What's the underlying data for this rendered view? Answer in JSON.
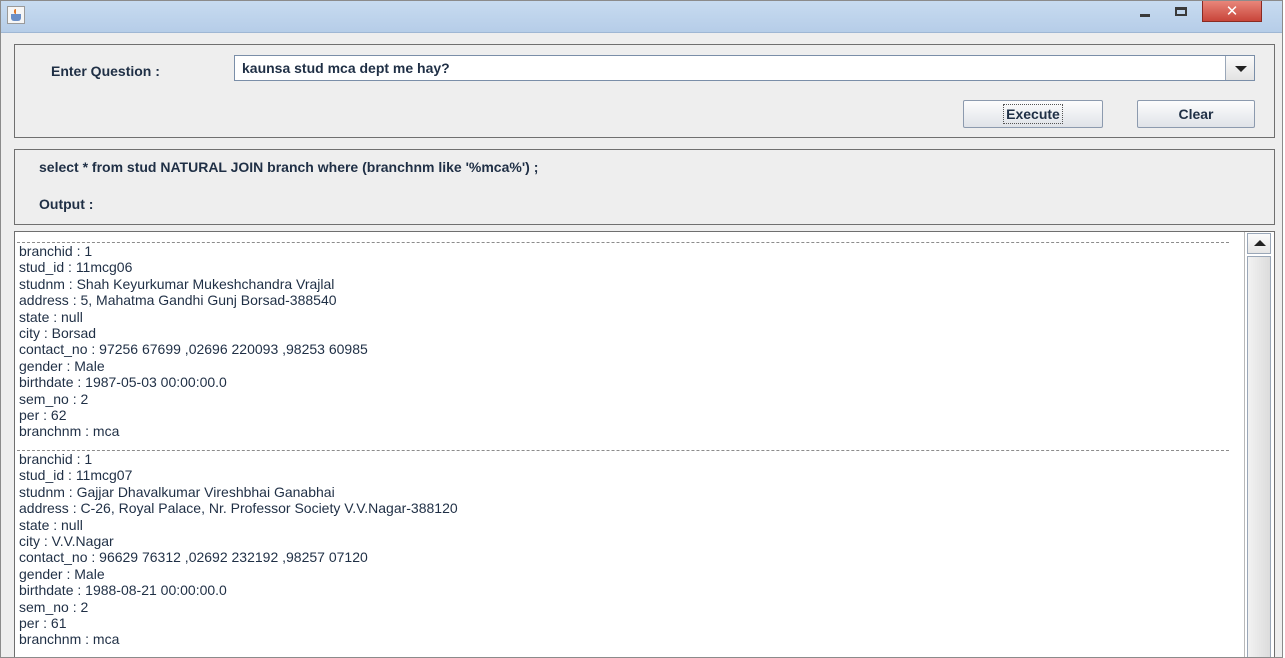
{
  "window": {
    "icon": "java-cup-icon",
    "close_glyph": "✕"
  },
  "question": {
    "label": "Enter Question :",
    "value": "kaunsa stud mca dept me hay?"
  },
  "buttons": {
    "execute": "Execute",
    "clear": "Clear"
  },
  "query": {
    "sql": "select * from stud NATURAL JOIN branch where (branchnm like '%mca%') ;",
    "output_label": "Output :"
  },
  "output": {
    "records": [
      [
        "branchid : 1",
        "stud_id : 11mcg06",
        "studnm : Shah Keyurkumar Mukeshchandra Vrajlal",
        "address : 5, Mahatma Gandhi Gunj Borsad-388540",
        "state : null",
        "city : Borsad",
        "contact_no : 97256 67699 ,02696 220093 ,98253 60985",
        "gender : Male",
        "birthdate : 1987-05-03 00:00:00.0",
        "sem_no : 2",
        "per : 62",
        "branchnm : mca"
      ],
      [
        "branchid : 1",
        "stud_id : 11mcg07",
        "studnm : Gajjar Dhavalkumar Vireshbhai Ganabhai",
        "address : C-26, Royal Palace, Nr. Professor Society V.V.Nagar-388120",
        "state : null",
        "city : V.V.Nagar",
        "contact_no : 96629 76312 ,02692 232192 ,98257 07120",
        "gender : Male",
        "birthdate : 1988-08-21 00:00:00.0",
        "sem_no : 2",
        "per : 61",
        "branchnm : mca"
      ]
    ]
  }
}
